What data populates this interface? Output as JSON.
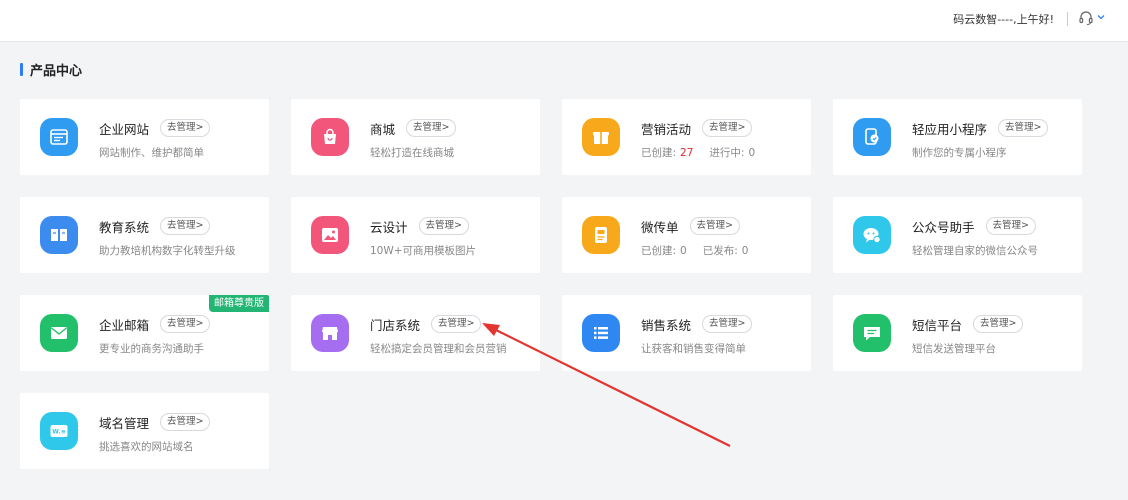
{
  "header": {
    "greeting": "码云数智----,上午好!",
    "support_icon": "headset-icon",
    "dropdown_icon": "chevron-down-icon"
  },
  "section": {
    "title": "产品中心"
  },
  "products": [
    {
      "name": "企业网站",
      "manage": "去管理>",
      "desc": "网站制作、维护都简单",
      "icon": "website-icon",
      "color": "#2f9cf2"
    },
    {
      "name": "商城",
      "manage": "去管理>",
      "desc": "轻松打造在线商城",
      "icon": "shopping-bag-icon",
      "color": "#f2577b"
    },
    {
      "name": "营销活动",
      "manage": "去管理>",
      "desc_label1": "已创建:",
      "desc_value1": "27",
      "desc_label2": "进行中:",
      "desc_value2": "0",
      "icon": "gift-icon",
      "color": "#f7a81b"
    },
    {
      "name": "轻应用小程序",
      "manage": "去管理>",
      "desc": "制作您的专属小程序",
      "icon": "mini-program-icon",
      "color": "#2f9cf2"
    },
    {
      "name": "教育系统",
      "manage": "去管理>",
      "desc": "助力教培机构数字化转型升级",
      "icon": "book-icon",
      "color": "#3c8cf0"
    },
    {
      "name": "云设计",
      "manage": "去管理>",
      "desc": "10W+可商用模板图片",
      "icon": "image-icon",
      "color": "#f2577b"
    },
    {
      "name": "微传单",
      "manage": "去管理>",
      "desc_label1": "已创建:",
      "desc_value1": "0",
      "desc_label2": "已发布:",
      "desc_value2": "0",
      "icon": "flyer-icon",
      "color": "#f7a81b"
    },
    {
      "name": "公众号助手",
      "manage": "去管理>",
      "desc": "轻松管理自家的微信公众号",
      "icon": "wechat-icon",
      "color": "#2fc7ea"
    },
    {
      "name": "企业邮箱",
      "manage": "去管理>",
      "desc": "更专业的商务沟通助手",
      "badge": "邮箱尊贵版",
      "icon": "mail-icon",
      "color": "#22c06a"
    },
    {
      "name": "门店系统",
      "manage": "去管理>",
      "desc": "轻松搞定会员管理和会员营销",
      "icon": "store-icon",
      "color": "#a56ef0"
    },
    {
      "name": "销售系统",
      "manage": "去管理>",
      "desc": "让获客和销售变得简单",
      "icon": "list-icon",
      "color": "#2f87f2"
    },
    {
      "name": "短信平台",
      "manage": "去管理>",
      "desc": "短信发送管理平台",
      "icon": "message-icon",
      "color": "#22c06a"
    },
    {
      "name": "域名管理",
      "manage": "去管理>",
      "desc": "挑选喜欢的网站域名",
      "icon": "domain-icon",
      "color": "#2fc7ea"
    }
  ],
  "annotation": {
    "type": "arrow",
    "color": "#e3342f",
    "points_to": "门店系统 去管理>"
  }
}
